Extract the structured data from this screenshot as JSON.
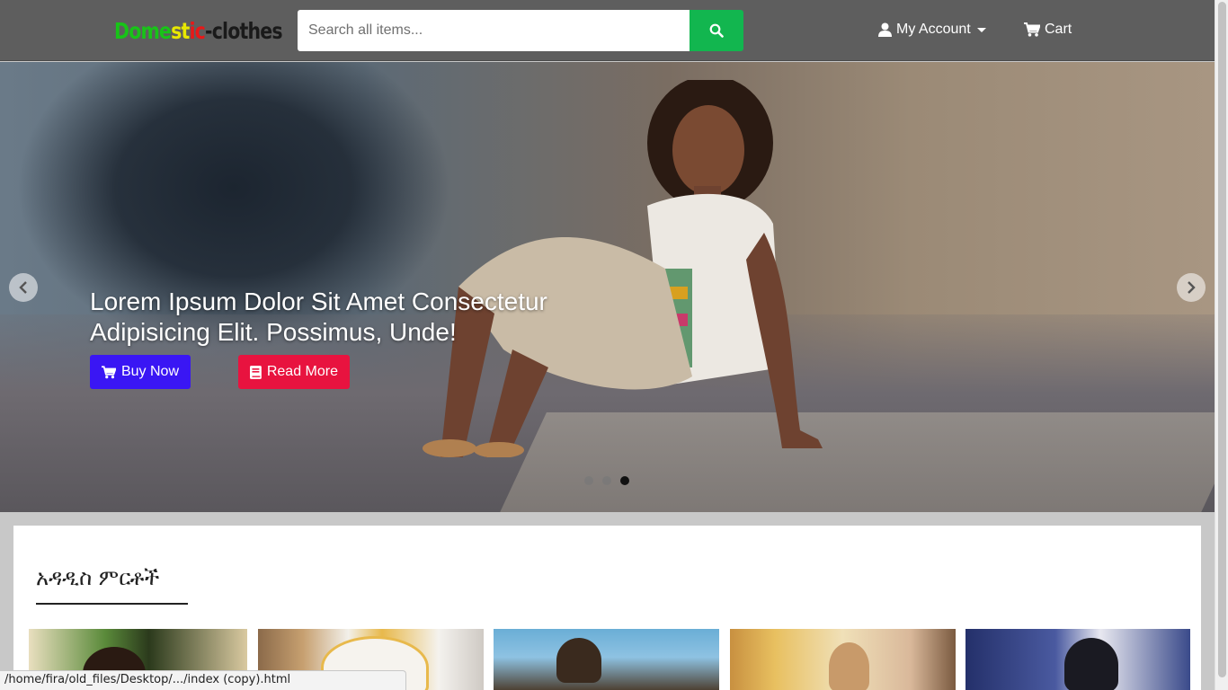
{
  "logo": {
    "part1": "Dome",
    "part2": "st",
    "part3": "ic",
    "part4": "-clothes"
  },
  "search": {
    "placeholder": "Search all items..."
  },
  "nav": {
    "account_label": "My Account",
    "cart_label": "Cart"
  },
  "hero": {
    "title": "Lorem Ipsum Dolor Sit Amet Consectetur Adipisicing Elit. Possimus, Unde!",
    "buy_label": "Buy Now",
    "read_label": "Read More",
    "slide_count": 3,
    "active_slide": 3
  },
  "section": {
    "title": "አዳዲስ ምርቶች"
  },
  "statusbar": {
    "url": "/home/fira/old_files/Desktop/.../index (copy).html"
  },
  "colors": {
    "navbar_bg": "#5e5e5e",
    "search_button": "#12b64f",
    "buy_button": "#3a16f4",
    "read_button": "#e8133f",
    "logo_green": "#18c418",
    "logo_yellow": "#e8e800",
    "logo_red": "#e81818"
  },
  "icons": {
    "search": "search-icon",
    "account": "user-icon",
    "cart": "cart-icon",
    "buy": "cart-icon",
    "read": "book-icon",
    "prev": "chevron-left-icon",
    "next": "chevron-right-icon"
  }
}
